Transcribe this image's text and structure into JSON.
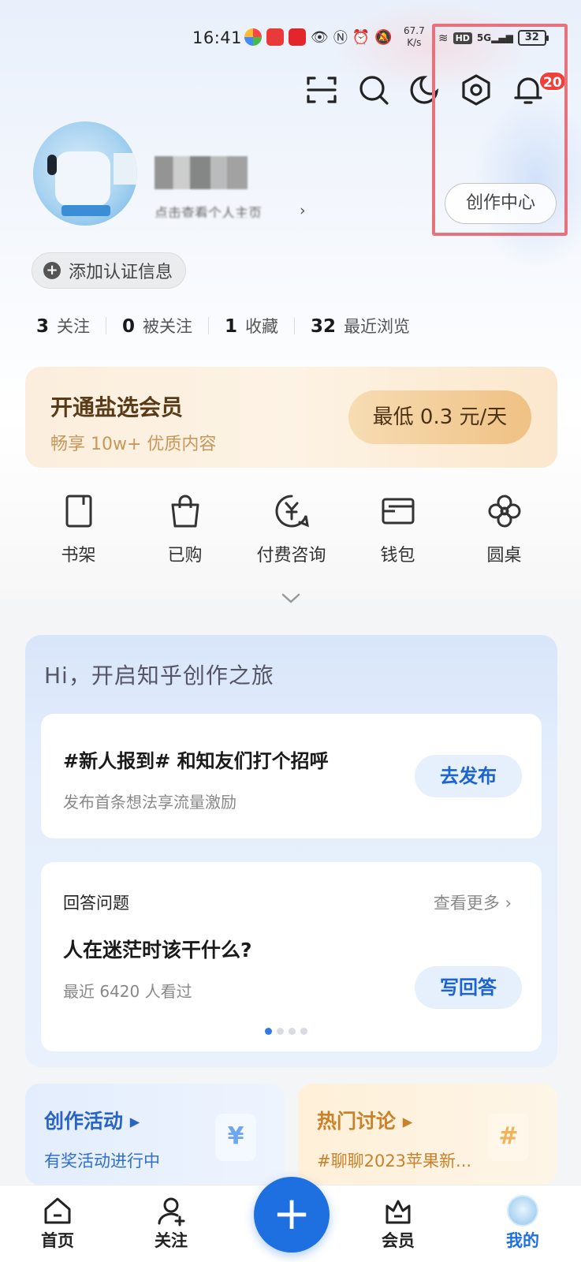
{
  "status_bar": {
    "time": "16:41",
    "net_speed": "67.7",
    "net_unit": "K/s",
    "hd": "HD",
    "signal": "5G",
    "battery": "32"
  },
  "header": {
    "notification_badge": "20",
    "creator_center_label": "创作中心"
  },
  "profile": {
    "username_blurred": "",
    "subtitle": "点击查看个人主页",
    "subtitle_arrow": "›",
    "add_cert_label": "添加认证信息"
  },
  "stats": [
    {
      "value": "3",
      "label": "关注"
    },
    {
      "value": "0",
      "label": "被关注"
    },
    {
      "value": "1",
      "label": "收藏"
    },
    {
      "value": "32",
      "label": "最近浏览"
    }
  ],
  "vip": {
    "title": "开通盐选会员",
    "subtitle": "畅享 10w+ 优质内容",
    "price_button": "最低 0.3 元/天"
  },
  "quick_links": [
    {
      "label": "书架",
      "icon": "bookshelf-icon"
    },
    {
      "label": "已购",
      "icon": "shopping-bag-icon"
    },
    {
      "label": "付费咨询",
      "icon": "paid-consult-icon"
    },
    {
      "label": "钱包",
      "icon": "wallet-icon"
    },
    {
      "label": "圆桌",
      "icon": "roundtable-icon"
    }
  ],
  "creation": {
    "title": "Hi，开启知乎创作之旅",
    "post": {
      "title": "#新人报到# 和知友们打个招呼",
      "subtitle": "发布首条想法享流量激励",
      "button": "去发布"
    },
    "answer": {
      "label": "回答问题",
      "more": "查看更多 ›",
      "question": "人在迷茫时该干什么?",
      "views": "最近 6420 人看过",
      "button": "写回答",
      "page_count": 4,
      "active_page": 1
    }
  },
  "tiles": {
    "activity": {
      "title": "创作活动 ▸",
      "subtitle": "有奖活动进行中",
      "deco": "¥"
    },
    "discussion": {
      "title": "热门讨论 ▸",
      "subtitle": "#聊聊2023苹果新...",
      "deco": "#"
    }
  },
  "bottom_nav": {
    "home": "首页",
    "follow": "关注",
    "plus": "+",
    "vip": "会员",
    "mine": "我的"
  },
  "colors": {
    "accent": "#1e6fe0",
    "highlight_box": "#e8727c",
    "badge": "#f1403c"
  }
}
